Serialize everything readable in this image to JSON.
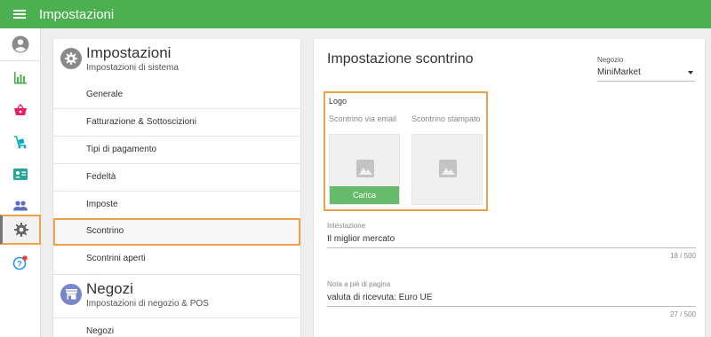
{
  "app": {
    "title": "Impostazioni"
  },
  "theme": {
    "primary": "#4caf50",
    "highlight": "#f0a04b"
  },
  "rail": {
    "items": [
      {
        "icon": "account-circle-icon"
      },
      {
        "icon": "bar-chart-icon",
        "color": "#4caf50"
      },
      {
        "icon": "basket-icon",
        "color": "#e91e63"
      },
      {
        "icon": "cart-icon",
        "color": "#00acc1"
      },
      {
        "icon": "contact-card-icon",
        "color": "#26a69a"
      },
      {
        "icon": "people-icon",
        "color": "#5c6bc0"
      },
      {
        "icon": "gear-icon",
        "active": true
      },
      {
        "icon": "help-icon",
        "color": "#2196f3",
        "badge_color": "#f44336"
      }
    ]
  },
  "settings": {
    "title": "Impostazioni",
    "subtitle": "Impostazioni di sistema",
    "items": [
      {
        "label": "Generale"
      },
      {
        "label": "Fatturazione & Sottoscizioni"
      },
      {
        "label": "Tipi di pagamento"
      },
      {
        "label": "Fedeltà"
      },
      {
        "label": "Imposte"
      },
      {
        "label": "Scontrino",
        "active": true
      },
      {
        "label": "Scontrini aperti"
      }
    ]
  },
  "stores": {
    "title": "Negozi",
    "subtitle": "Impostazioni di negozio & POS",
    "items": [
      {
        "label": "Negozi"
      }
    ]
  },
  "receipt": {
    "title": "Impostazione scontrino",
    "store_label": "Negozio",
    "store_value": "MiniMarket",
    "logo_title": "Logo",
    "email_caption": "Scontrino via email",
    "printed_caption": "Scontrino stampato",
    "upload_label": "Carica",
    "header_label": "Intestazione",
    "header_value": "Il miglior mercato",
    "header_count": "18 / 500",
    "footer_label": "Nota a piè di pagina",
    "footer_value": "valuta di ricevuta: Euro UE",
    "footer_count": "27 / 500"
  }
}
